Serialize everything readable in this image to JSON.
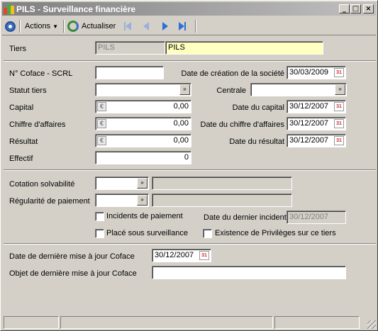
{
  "window": {
    "title": "PILS - Surveillance financière"
  },
  "titlebar_buttons": {
    "minimize": "_",
    "maximize": "□",
    "close": "×"
  },
  "toolbar": {
    "actions_label": "Actions",
    "refresh_label": "Actualiser"
  },
  "tiers": {
    "label": "Tiers",
    "code": "PILS",
    "name": "PILS"
  },
  "coface": {
    "n_coface_label": "N° Coface - SCRL",
    "n_coface_value": "",
    "date_creation_label": "Date de création de la société",
    "date_creation_value": "30/03/2009",
    "statut_label": "Statut tiers",
    "statut_value": "",
    "centrale_label": "Centrale",
    "centrale_value": "",
    "capital_label": "Capital",
    "capital_value": "0,00",
    "date_capital_label": "Date du capital",
    "date_capital_value": "30/12/2007",
    "ca_label": "Chiffre d'affaires",
    "ca_value": "0,00",
    "date_ca_label": "Date du chiffre d'affaires",
    "date_ca_value": "30/12/2007",
    "resultat_label": "Résultat",
    "resultat_value": "0,00",
    "date_resultat_label": "Date du résultat",
    "date_resultat_value": "30/12/2007",
    "effectif_label": "Effectif",
    "effectif_value": "0"
  },
  "solvabilite": {
    "cotation_label": "Cotation solvabilité",
    "cotation_value": "",
    "cotation_desc": "",
    "regularite_label": "Régularité de paiement",
    "regularite_value": "",
    "regularite_desc": "",
    "incidents_label": "Incidents de paiement",
    "date_incident_label": "Date du dernier incident",
    "date_incident_value": "30/12/2007",
    "surveillance_label": "Placé sous surveillance",
    "privileges_label": "Existence de Privilèges sur ce tiers"
  },
  "maj": {
    "date_label": "Date de dernière mise à jour Coface",
    "date_value": "30/12/2007",
    "objet_label": "Objet de dernière mise à jour Coface",
    "objet_value": ""
  },
  "icons": {
    "calendar_day": "31",
    "euro": "€",
    "dropdown": "»"
  }
}
